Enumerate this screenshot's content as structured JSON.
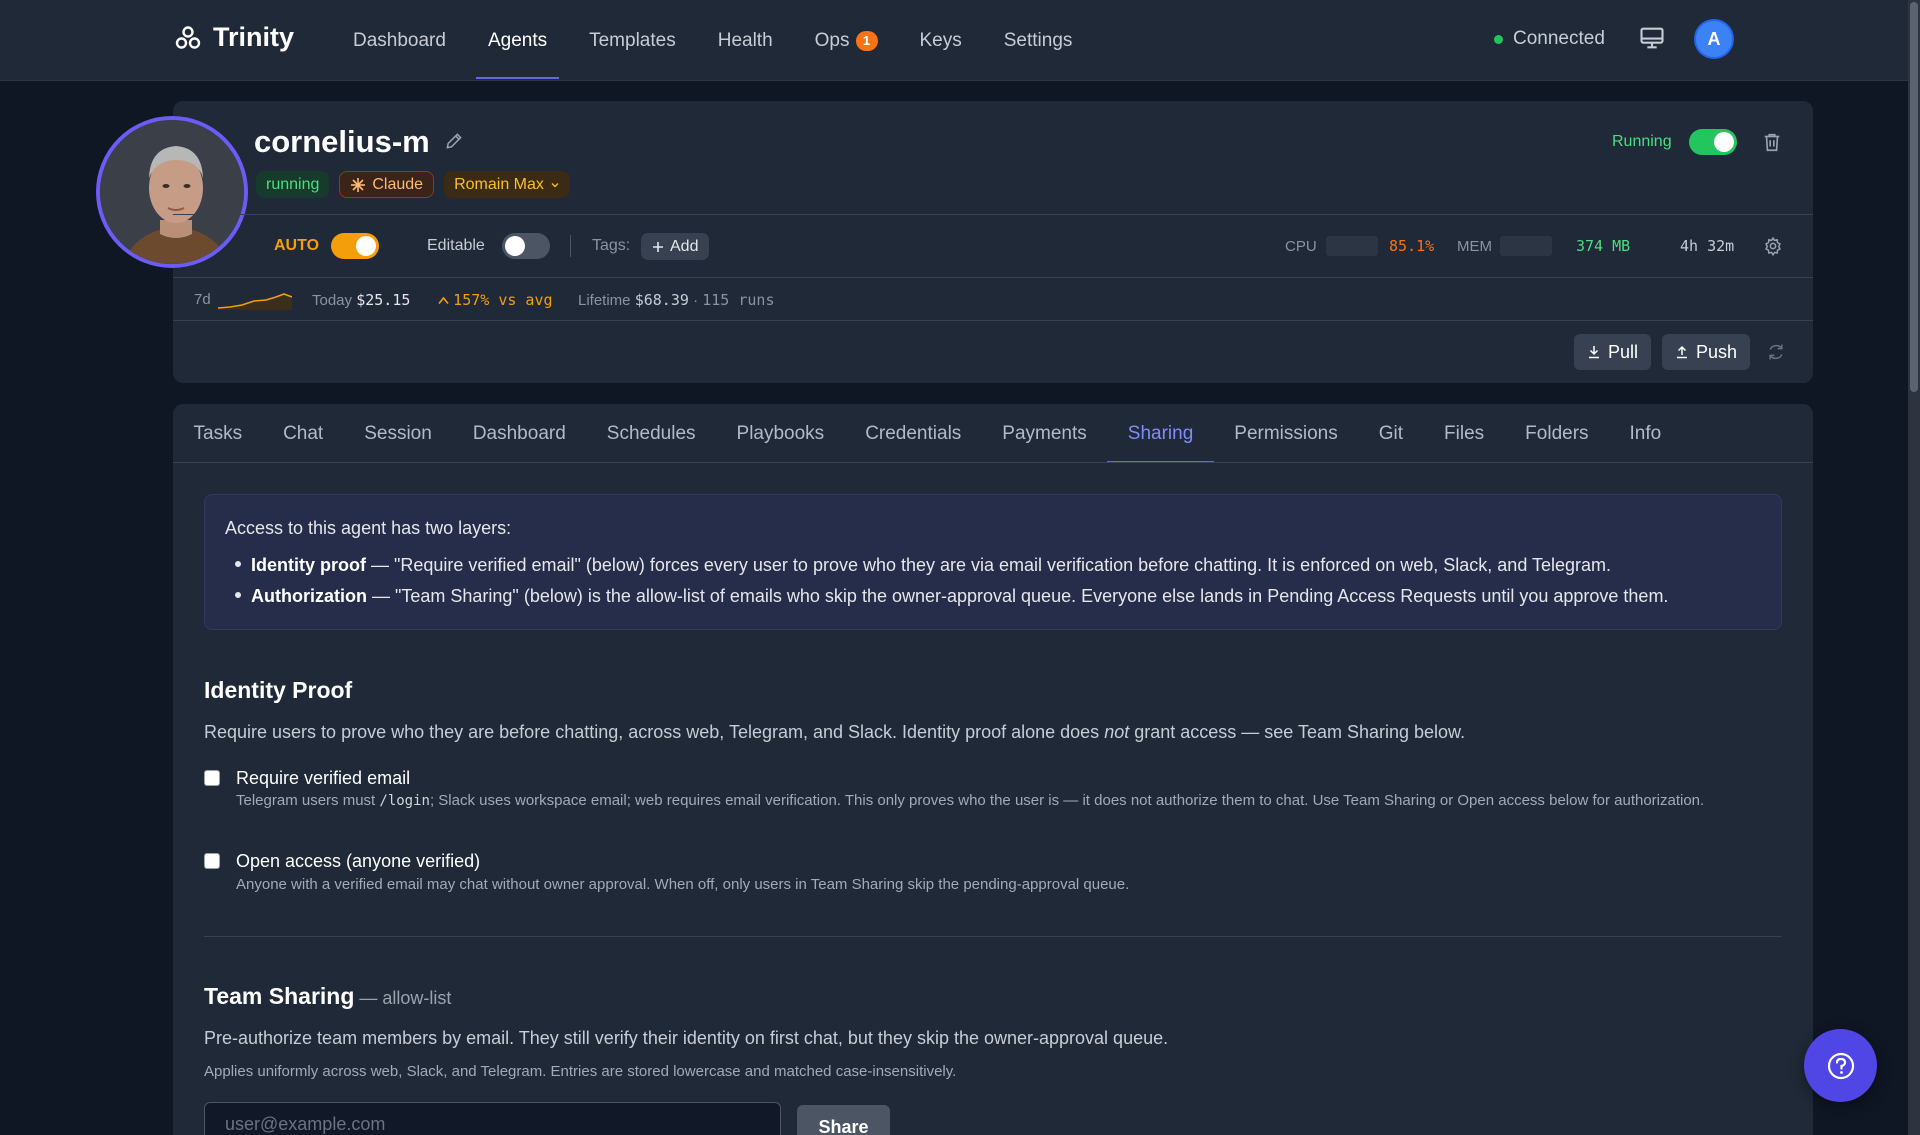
{
  "nav": {
    "brand": "Trinity",
    "links": [
      {
        "label": "Dashboard"
      },
      {
        "label": "Agents",
        "active": true
      },
      {
        "label": "Templates"
      },
      {
        "label": "Health"
      },
      {
        "label": "Ops",
        "badge": "1"
      },
      {
        "label": "Keys"
      },
      {
        "label": "Settings"
      }
    ],
    "connection_status": "Connected",
    "user_initial": "A"
  },
  "agent": {
    "name": "cornelius-m",
    "status_badge": "running",
    "model_badge": "Claude",
    "persona_badge": "Romain Max",
    "run_status": "Running",
    "run_toggle_on": true,
    "auto_label": "AUTO",
    "auto_on": true,
    "editable_label": "Editable",
    "editable_on": false,
    "tags_label": "Tags:",
    "add_tag_label": "Add",
    "cpu_label": "CPU",
    "cpu_value": "85.1%",
    "mem_label": "MEM",
    "mem_value": "374 MB",
    "uptime": "4h 32m"
  },
  "costs": {
    "period": "7d",
    "today_label": "Today",
    "today_value": "$25.15",
    "vs_avg": "157% vs avg",
    "lifetime_label": "Lifetime",
    "lifetime_value": "$68.39",
    "separator": "·",
    "runs": "115 runs"
  },
  "actions": {
    "pull_label": "Pull",
    "push_label": "Push"
  },
  "tabs": [
    {
      "label": "Tasks"
    },
    {
      "label": "Chat"
    },
    {
      "label": "Session"
    },
    {
      "label": "Dashboard"
    },
    {
      "label": "Schedules"
    },
    {
      "label": "Playbooks"
    },
    {
      "label": "Credentials"
    },
    {
      "label": "Payments"
    },
    {
      "label": "Sharing",
      "active": true
    },
    {
      "label": "Permissions"
    },
    {
      "label": "Git"
    },
    {
      "label": "Files"
    },
    {
      "label": "Folders"
    },
    {
      "label": "Info"
    }
  ],
  "sharing": {
    "intro": "Access to this agent has two layers:",
    "bullet1_term": "Identity proof",
    "bullet1_text": " — \"Require verified email\" (below) forces every user to prove who they are via email verification before chatting. It is enforced on web, Slack, and Telegram.",
    "bullet2_term": "Authorization",
    "bullet2_text": " — \"Team Sharing\" (below) is the allow-list of emails who skip the owner-approval queue. Everyone else lands in Pending Access Requests until you approve them.",
    "identity_title": "Identity Proof",
    "identity_desc_a": "Require users to prove who they are before chatting, across web, Telegram, and Slack. Identity proof alone does ",
    "identity_desc_em": "not",
    "identity_desc_b": " grant access — see Team Sharing below.",
    "opt1_title": "Require verified email",
    "opt1_desc_a": "Telegram users must ",
    "opt1_desc_code": "/login",
    "opt1_desc_b": "; Slack uses workspace email; web requires email verification. This only proves who the user is — it does not authorize them to chat. Use Team Sharing or Open access below for authorization.",
    "opt1_checked": false,
    "opt2_title": "Open access (anyone verified)",
    "opt2_desc": "Anyone with a verified email may chat without owner approval. When off, only users in Team Sharing skip the pending-approval queue.",
    "opt2_checked": false,
    "team_title": "Team Sharing",
    "team_suffix": " — allow-list",
    "team_desc": "Pre-authorize team members by email. They still verify their identity on first chat, but they skip the owner-approval queue.",
    "team_note": "Applies uniformly across web, Slack, and Telegram. Entries are stored lowercase and matched case-insensitively.",
    "email_placeholder": "user@example.com",
    "share_label": "Share"
  },
  "colors": {
    "accent": "#6366f1",
    "running": "#22c55e",
    "auto": "#f59e0b",
    "cpu": "#f97316",
    "mem": "#4ade80"
  }
}
